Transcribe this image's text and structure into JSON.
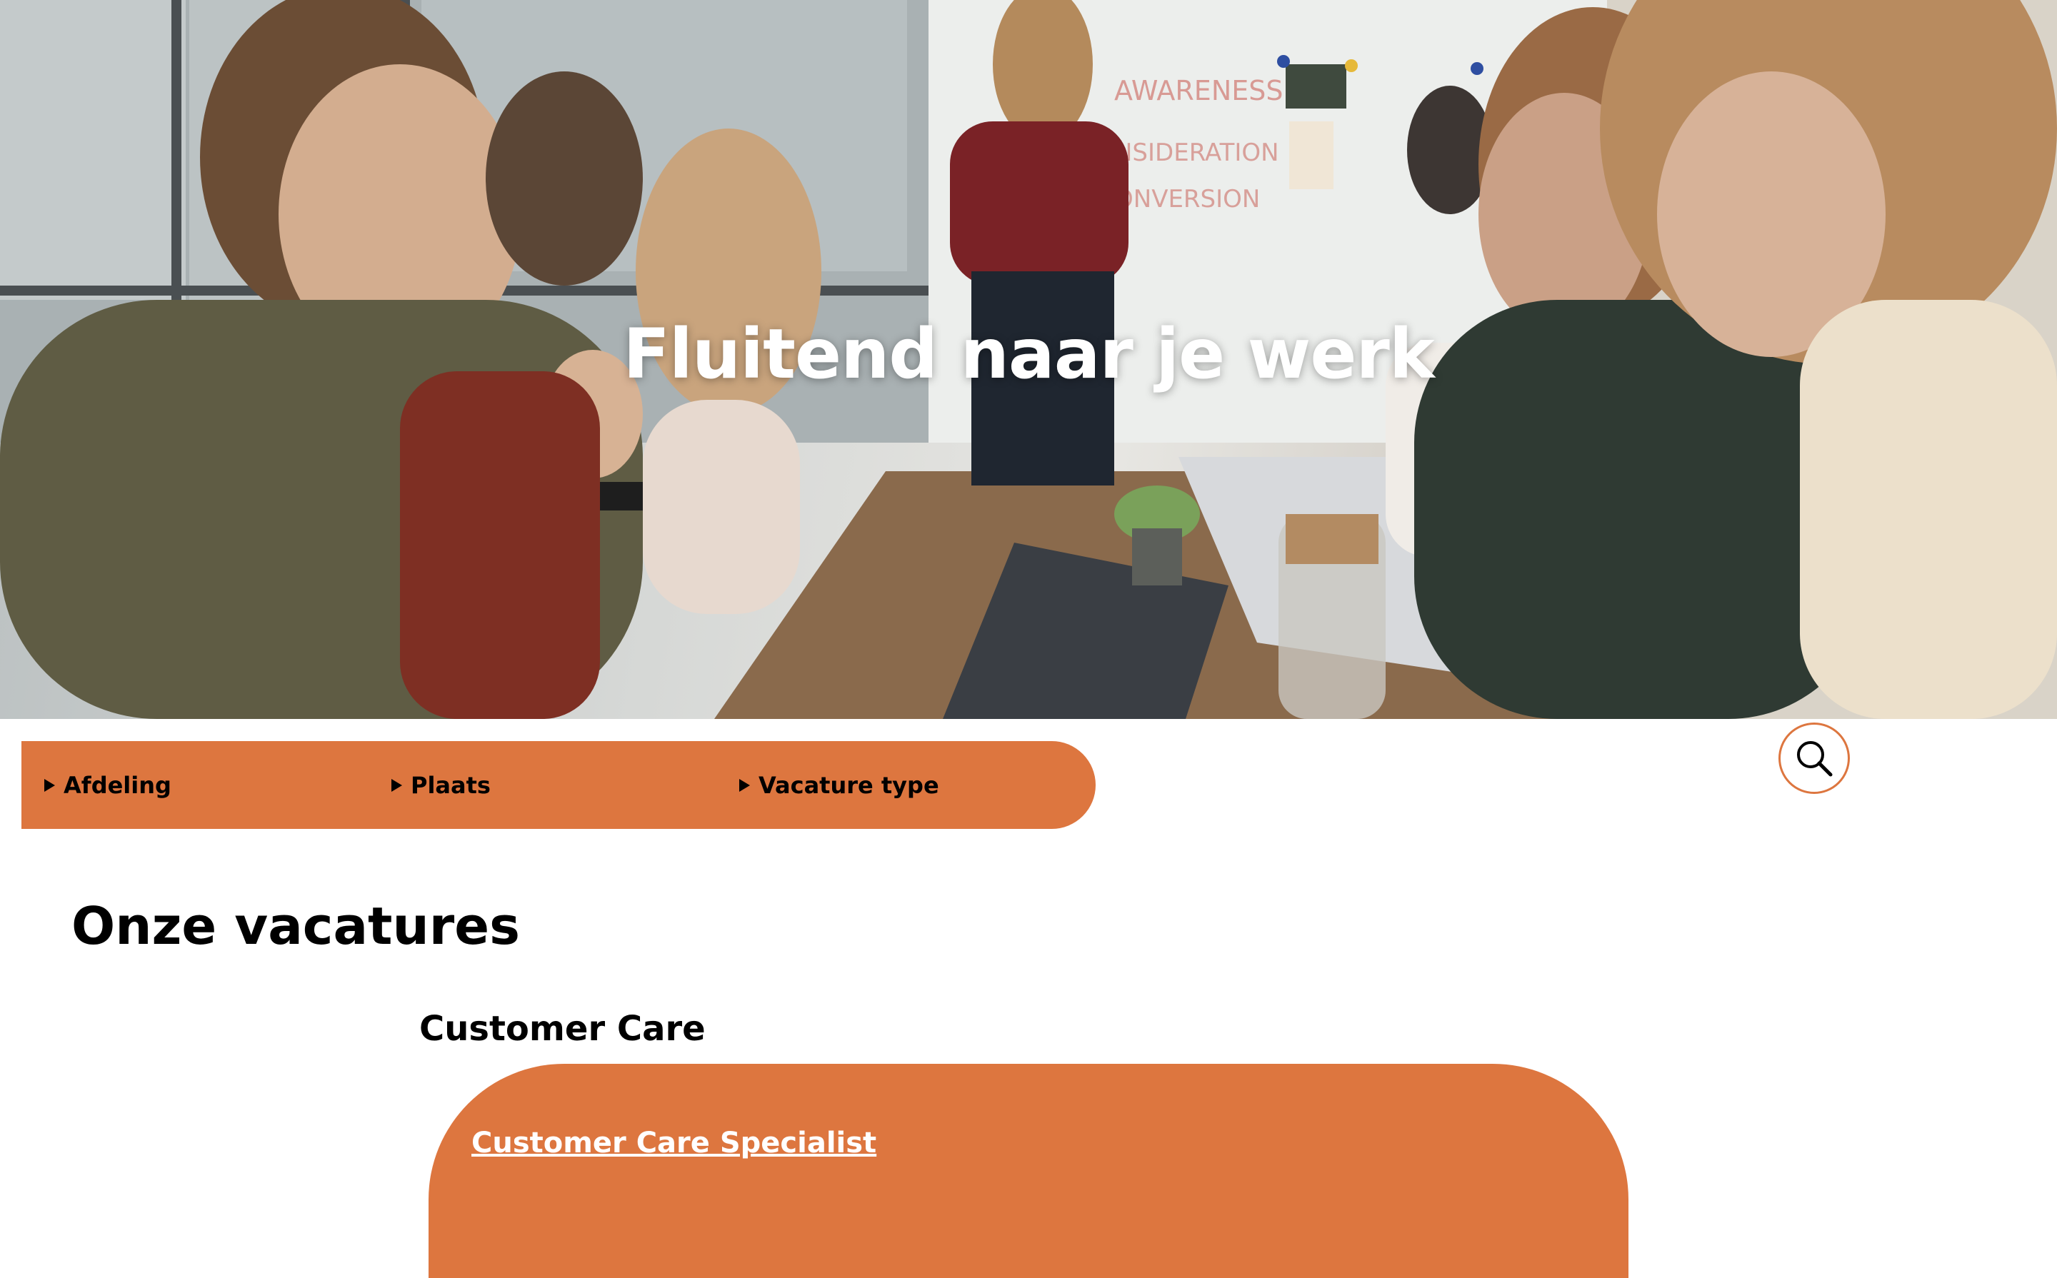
{
  "hero": {
    "title": "Fluitend naar je werk"
  },
  "filters": {
    "items": [
      {
        "label": "Afdeling"
      },
      {
        "label": "Plaats"
      },
      {
        "label": "Vacature type"
      }
    ],
    "search_icon": "search-icon"
  },
  "main": {
    "title": "Onze vacatures",
    "sections": [
      {
        "title": "Customer Care",
        "jobs": [
          {
            "title": "Customer Care Specialist"
          }
        ]
      }
    ]
  },
  "colors": {
    "accent": "#dd763f",
    "hero_text": "#ffffff"
  }
}
